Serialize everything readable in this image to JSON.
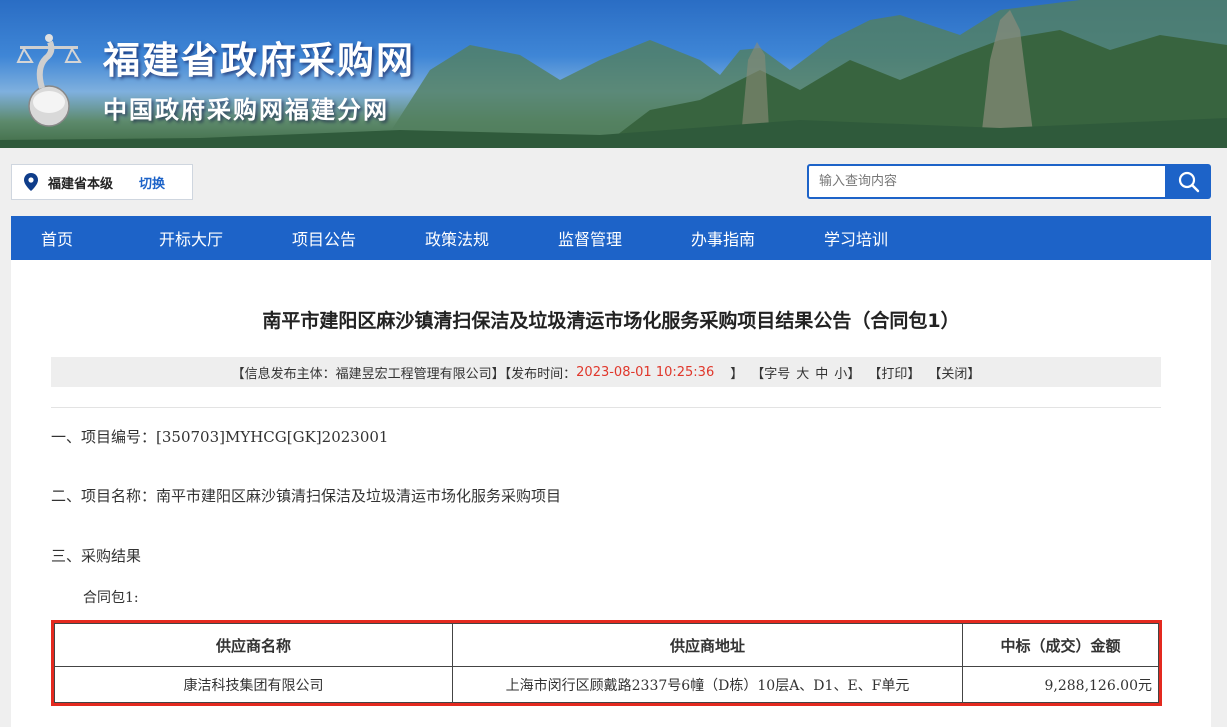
{
  "header": {
    "title": "福建省政府采购网",
    "subtitle": "中国政府采购网福建分网"
  },
  "region": {
    "name": "福建省本级",
    "switch_label": "切换"
  },
  "search": {
    "placeholder": "输入查询内容"
  },
  "nav": {
    "items": [
      "首页",
      "开标大厅",
      "项目公告",
      "政策法规",
      "监督管理",
      "办事指南",
      "学习培训"
    ]
  },
  "article": {
    "title": "南平市建阳区麻沙镇清扫保洁及垃圾清运市场化服务采购项目结果公告（合同包1）",
    "meta": {
      "publisher_prefix": "【信息发布主体：福建昱宏工程管理有限公司】【发布时间：",
      "publish_time": "2023-08-01 10:25:36",
      "publish_suffix": "】",
      "font_size_label": "【字号",
      "font_large": "大",
      "font_medium": "中",
      "font_small": "小",
      "font_size_end": "】",
      "print_label": "【打印】",
      "close_label": "【关闭】"
    },
    "sections": {
      "s1": "一、项目编号：[350703]MYHCG[GK]2023001",
      "s2": "二、项目名称：南平市建阳区麻沙镇清扫保洁及垃圾清运市场化服务采购项目",
      "s3": "三、采购结果",
      "package": "合同包1:"
    },
    "table": {
      "headers": [
        "供应商名称",
        "供应商地址",
        "中标（成交）金额"
      ],
      "rows": [
        [
          "康洁科技集团有限公司",
          "上海市闵行区顾戴路2337号6幢（D栋）10层A、D1、E、F单元",
          "9,288,126.00元"
        ]
      ]
    }
  },
  "colors": {
    "brand_blue": "#1d63c8",
    "highlight_red": "#e4291f",
    "time_red": "#e0372b"
  }
}
